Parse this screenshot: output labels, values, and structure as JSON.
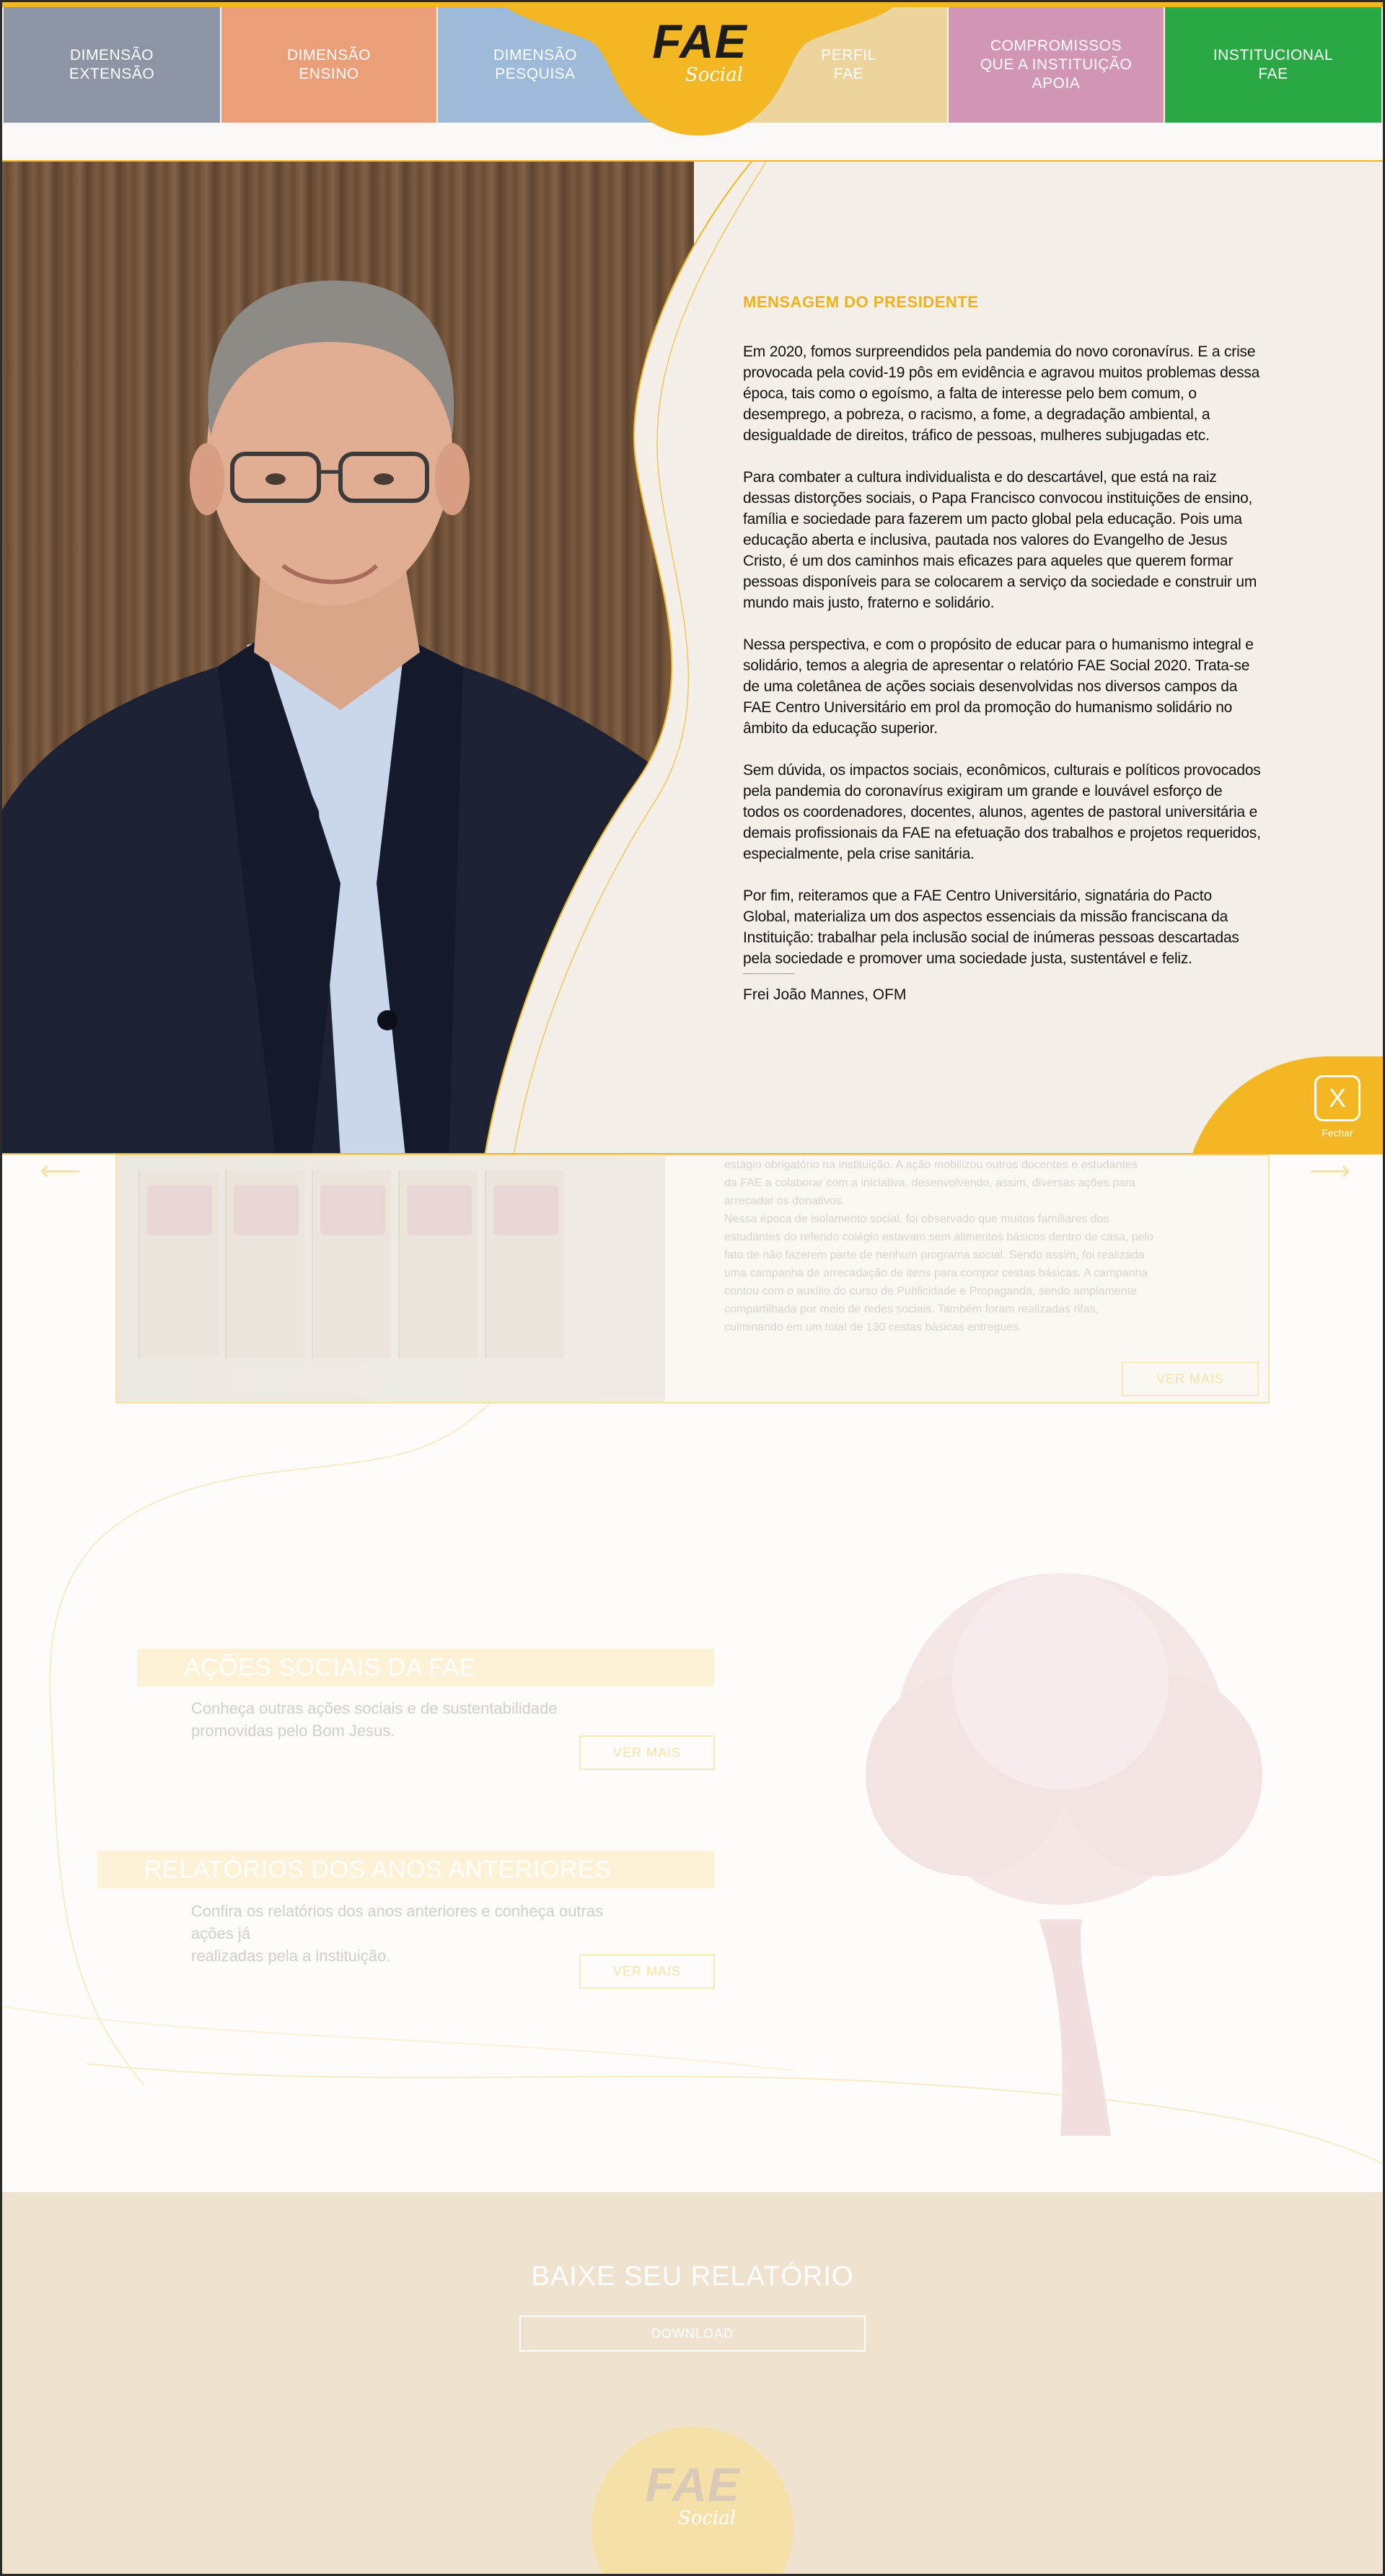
{
  "nav": {
    "items": [
      {
        "label": "DIMENSÃO\nEXTENSÃO",
        "color": "#8d95a5"
      },
      {
        "label": "DIMENSÃO\nENSINO",
        "color": "#eb9f79"
      },
      {
        "label": "DIMENSÃO\nPESQUISA",
        "color": "#9dbbd9"
      },
      {
        "label": "PERFIL\nFAE",
        "color": "#edd49c"
      },
      {
        "label": "COMPROMISSOS\nQUE A INSTITUIÇÃO\nAPOIA",
        "color": "#d196b4"
      },
      {
        "label": "INSTITUCIONAL\nFAE",
        "color": "#2aa844"
      }
    ],
    "logo_main": "FAE",
    "logo_sub": "Social",
    "brand_color": "#f2b722"
  },
  "modal": {
    "title": "MENSAGEM DO PRESIDENTE",
    "paragraphs": [
      "Em 2020, fomos surpreendidos pela pandemia do novo coronavírus. E a crise provocada pela covid-19 pôs em evidência e agravou muitos problemas dessa época, tais como o egoísmo, a falta de interesse pelo bem comum, o desemprego, a pobreza, o racismo, a fome, a degradação ambiental, a desigualdade de direitos, tráfico de pessoas, mulheres subjugadas etc.",
      "Para combater a cultura individualista e do descartável, que está na raiz dessas distorções sociais, o Papa Francisco convocou instituições de ensino, família e sociedade para fazerem um pacto global pela educação. Pois uma educação aberta e inclusiva, pautada nos valores do Evangelho de Jesus Cristo, é um dos caminhos mais eficazes para aqueles que querem formar pessoas disponíveis para se colocarem a serviço da sociedade e construir um mundo mais justo, fraterno e solidário.",
      "Nessa perspectiva, e com o propósito de educar para o humanismo integral e solidário, temos a alegria de apresentar o relatório FAE Social 2020. Trata-se de uma coletânea de ações sociais desenvolvidas nos diversos campos da FAE Centro Universitário em prol da promoção do humanismo solidário no âmbito da educação superior.",
      "Sem dúvida, os impactos sociais, econômicos, culturais e políticos provocados pela pandemia do coronavírus exigiram um grande e louvável esforço de todos os coordenadores, docentes, alunos, agentes de pastoral universitária e demais profissionais da FAE na efetuação dos trabalhos e projetos requeridos, especialmente, pela crise sanitária.",
      "Por fim, reiteramos que a FAE Centro Universitário, signatária do Pacto Global, materializa um dos aspectos essenciais da missão franciscana da Instituição: trabalhar pela inclusão social de inúmeras pessoas descartadas pela sociedade e promover uma sociedade justa, sustentável e feliz."
    ],
    "signature": "Frei João Mannes, OFM",
    "close_symbol": "X",
    "close_label": "Fechar"
  },
  "carousel": {
    "text": "estágio obrigatório na instituição. A ação mobilizou outros docentes e estudantes\nda FAE a colaborar com a iniciativa, desenvolvendo, assim, diversas ações para\narrecadar os donativos.\nNessa época de isolamento social, foi observado que muitos familiares dos\nestudantes do referido colégio estavam sem alimentos básicos dentro de casa, pelo\nfato de não fazerem parte de nenhum programa social. Sendo assim, foi realizada\numa campanha de arrecadação de itens para compor cestas básicas. A campanha\ncontou com o auxílio do curso de Publicidade e Propaganda, sendo amplamente\ncompartilhada por meio de redes sociais. Também foram realizadas rifas,\nculminando em um total de 130 cestas básicas entregues.",
    "button": "VER MAIS",
    "prev": "⟵",
    "next": "⟶"
  },
  "acoes": {
    "heading": "AÇÕES SOCIAIS DA FAE",
    "text": "Conheça outras ações sociais e de sustentabilidade\npromovidas pelo Bom Jesus.",
    "button": "VER MAIS"
  },
  "relatorios": {
    "heading": "RELATÓRIOS DOS ANOS ANTERIORES",
    "text": "Confira os relatórios dos anos anteriores e conheça outras ações já\nrealizadas pela a instituição.",
    "button": "VER MAIS"
  },
  "download": {
    "title": "BAIXE SEU RELATÓRIO",
    "button": "DOWNLOAD"
  },
  "footer": {
    "logo_main": "FAE",
    "logo_sub": "Social"
  }
}
